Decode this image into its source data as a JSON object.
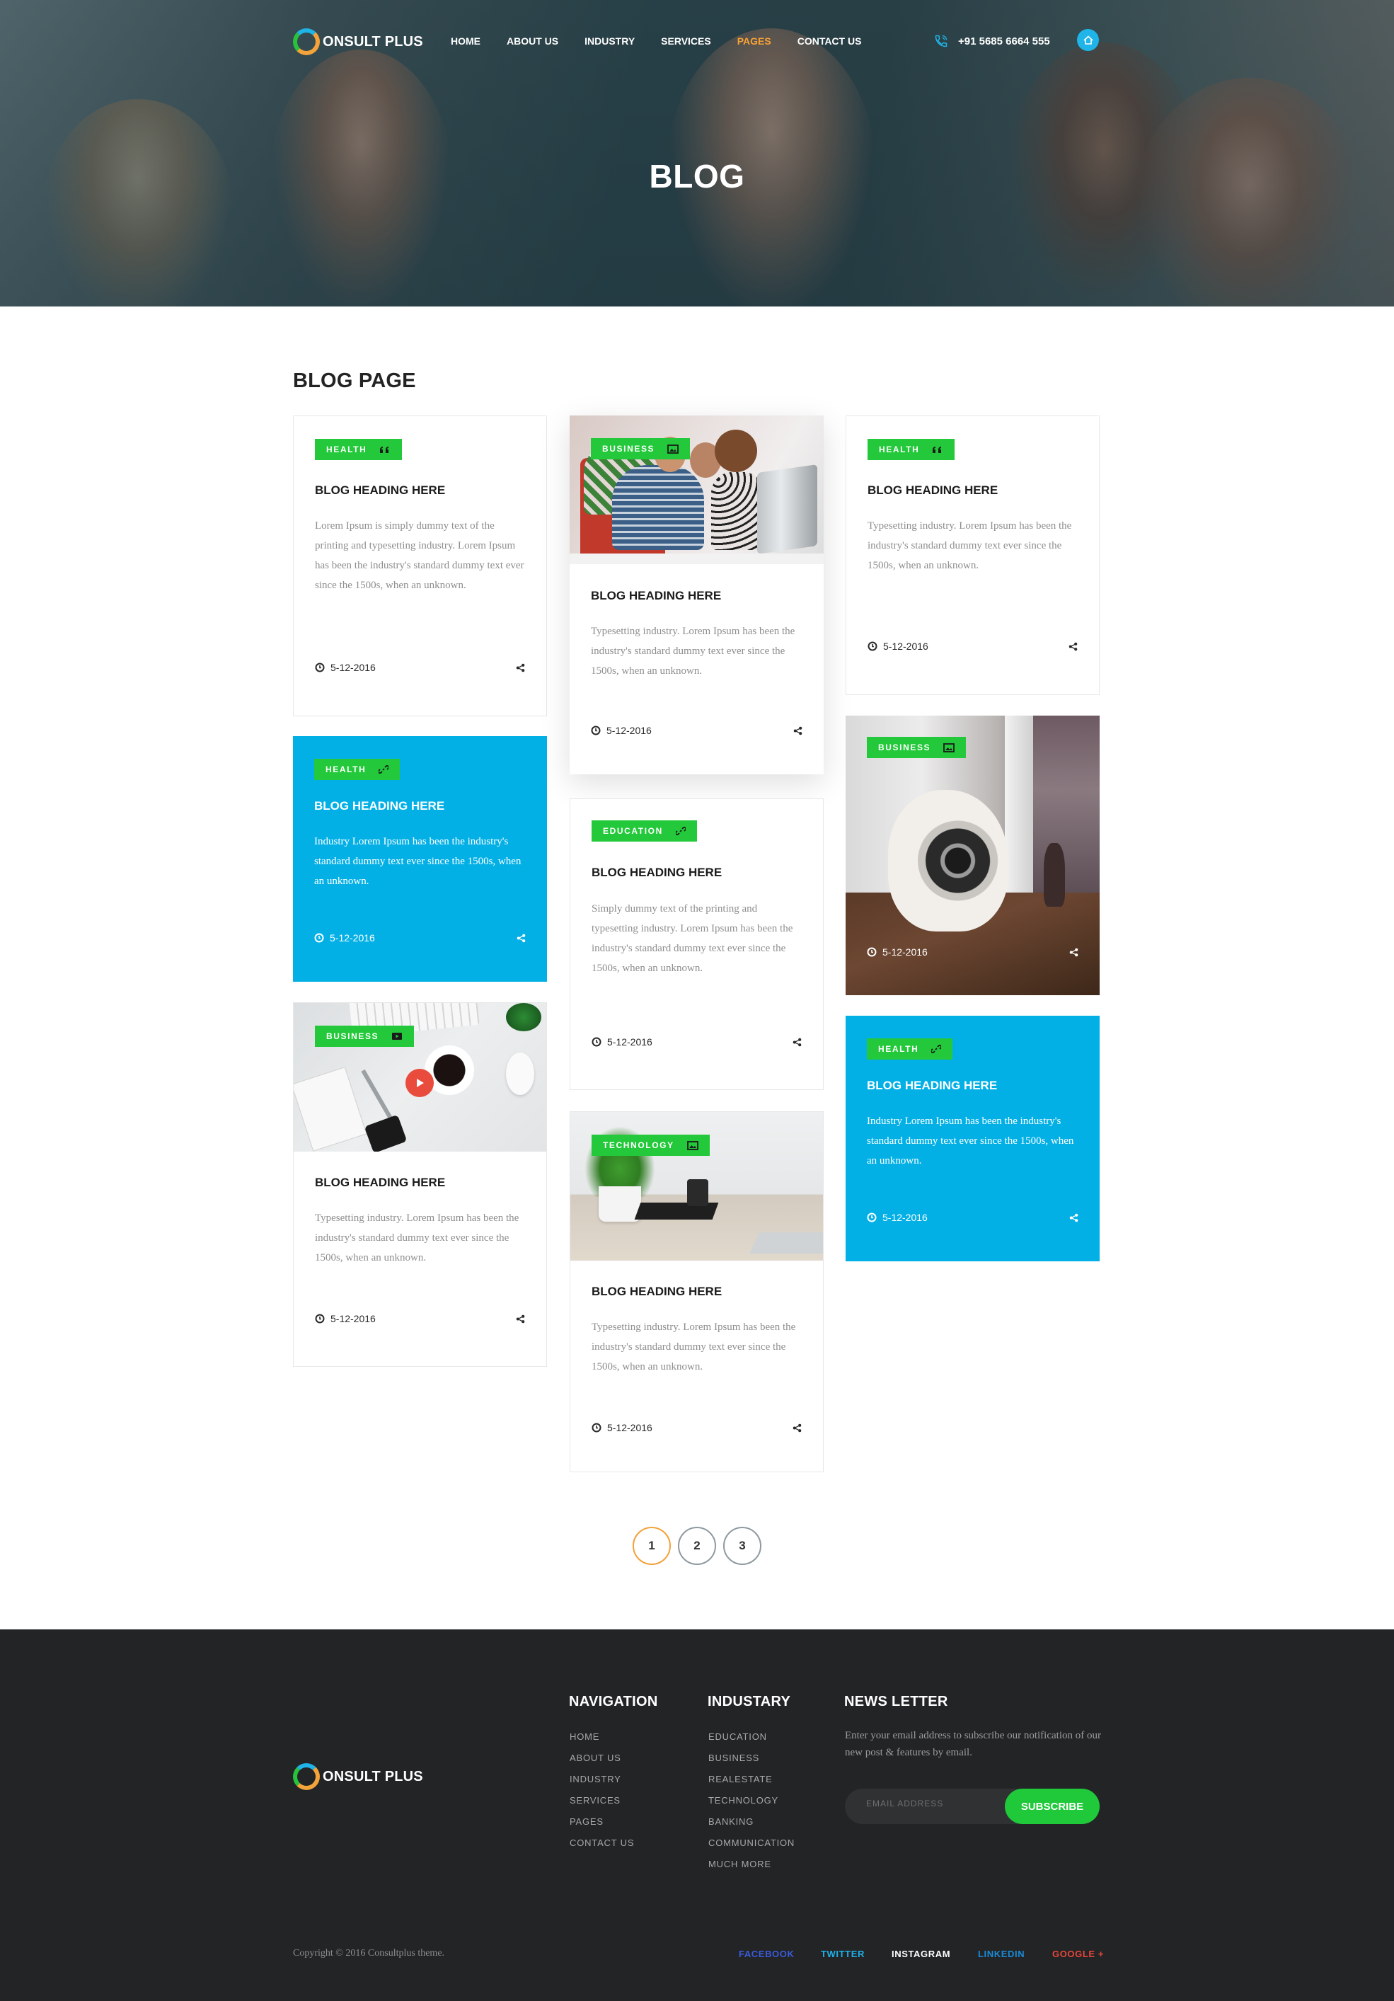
{
  "header": {
    "logo_text": "ONSULT PLUS",
    "nav": [
      "HOME",
      "ABOUT US",
      "INDUSTRY",
      "SERVICES",
      "PAGES",
      "CONTACT US"
    ],
    "active_nav": "PAGES",
    "phone": "+91 5685 6664 555",
    "hero_title": "BLOG"
  },
  "page": {
    "section_title": "BLOG PAGE"
  },
  "posts": [
    {
      "tag": "HEALTH",
      "tag_icon": "quote-icon",
      "title": "BLOG HEADING HERE",
      "text": "Lorem Ipsum is simply dummy text of the printing and typesetting industry. Lorem Ipsum has been the industry's standard dummy text ever since the 1500s, when an unknown.",
      "date": "5-12-2016",
      "style": "plain"
    },
    {
      "tag": "BUSINESS",
      "tag_icon": "image-icon",
      "title": "BLOG HEADING HERE",
      "text": "Typesetting industry. Lorem Ipsum has been the industry's standard dummy text ever since the 1500s, when an unknown.",
      "date": "5-12-2016",
      "style": "image",
      "image": "team-at-computer-photo"
    },
    {
      "tag": "HEALTH",
      "tag_icon": "quote-icon",
      "title": "BLOG HEADING HERE",
      "text": "Typesetting industry. Lorem Ipsum has been the industry's standard dummy text ever since the 1500s, when an unknown.",
      "date": "5-12-2016",
      "style": "plain"
    },
    {
      "tag": "HEALTH",
      "tag_icon": "link-icon",
      "title": "BLOG HEADING HERE",
      "text": "Industry Lorem Ipsum has been the industry's standard dummy text ever since the 1500s, when an unknown.",
      "date": "5-12-2016",
      "style": "blue"
    },
    {
      "tag": "EDUCATION",
      "tag_icon": "link-icon",
      "title": "BLOG HEADING HERE",
      "text": "Simply dummy text of the printing and typesetting industry. Lorem Ipsum has been the industry's standard dummy text ever since the 1500s, when an unknown.",
      "date": "5-12-2016",
      "style": "plain"
    },
    {
      "tag": "BUSINESS",
      "tag_icon": "image-icon",
      "date": "5-12-2016",
      "style": "photo",
      "image": "speaker-photo"
    },
    {
      "tag": "BUSINESS",
      "tag_icon": "video-icon",
      "title": "BLOG HEADING HERE",
      "text": "Typesetting industry. Lorem Ipsum has been the industry's standard dummy text ever since the 1500s, when an unknown.",
      "date": "5-12-2016",
      "style": "image",
      "image": "desk-coffee-video"
    },
    {
      "tag": "TECHNOLOGY",
      "tag_icon": "image-icon",
      "title": "BLOG HEADING HERE",
      "text": "Typesetting industry. Lorem Ipsum has been the industry's standard dummy text ever since the 1500s, when an unknown.",
      "date": "5-12-2016",
      "style": "image",
      "image": "desk-plant-photo"
    },
    {
      "tag": "HEALTH",
      "tag_icon": "link-icon",
      "title": "BLOG HEADING HERE",
      "text": "Industry Lorem Ipsum has been the industry's standard dummy text ever since the 1500s, when an unknown.",
      "date": "5-12-2016",
      "style": "blue"
    }
  ],
  "pagination": {
    "pages": [
      "1",
      "2",
      "3"
    ],
    "current": "1"
  },
  "footer": {
    "logo_text": "ONSULT PLUS",
    "navigation": {
      "title": "NAVIGATION",
      "items": [
        "HOME",
        "ABOUT US",
        "INDUSTRY",
        "SERVICES",
        "PAGES",
        "CONTACT US"
      ]
    },
    "industry": {
      "title": "INDUSTARY",
      "items": [
        "EDUCATION",
        "BUSINESS",
        "REALESTATE",
        "TECHNOLOGY",
        "BANKING",
        "COMMUNICATION",
        "MUCH MORE"
      ]
    },
    "newsletter": {
      "title": "NEWS LETTER",
      "text": "Enter your email address to subscribe our notification of our new post & features by email.",
      "placeholder": "EMAIL ADDRESS",
      "button": "SUBSCRIBE"
    },
    "copyright": "Copyright © 2016 Consultplus theme.",
    "social": [
      {
        "label": "FACEBOOK",
        "color": "#3b5bdb"
      },
      {
        "label": "TWITTER",
        "color": "#1fb0e8"
      },
      {
        "label": "INSTAGRAM",
        "color": "#ffffff"
      },
      {
        "label": "LINKEDIN",
        "color": "#1a8bd6"
      },
      {
        "label": "GOOGLE +",
        "color": "#e9463a"
      }
    ]
  },
  "colors": {
    "accent": "#23c93a",
    "blue": "#03b0e6",
    "orange": "#f6a236",
    "footer_bg": "#222426"
  }
}
